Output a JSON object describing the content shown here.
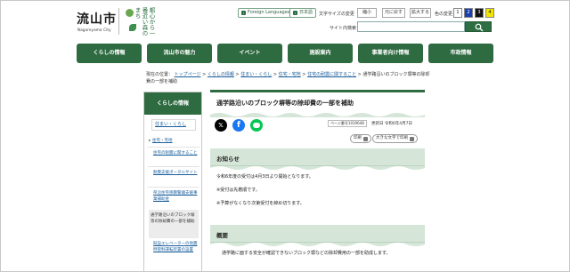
{
  "header": {
    "logo_kanji": "流山市",
    "logo_roman": "Nagareyama City",
    "slogan": "都心から一番近い森のまち",
    "lang_button": "Foreign Languages",
    "japanese_button": "日本語",
    "text_size_label": "文字サイズの変更",
    "text_size_shrink": "縮小",
    "text_size_reset": "元に戻す",
    "text_size_enlarge": "拡大する",
    "color_label": "色の変更",
    "color_options": [
      "1",
      "2",
      "3",
      "4"
    ],
    "search_label": "サイト内検索",
    "search_placeholder": ""
  },
  "gnav": [
    "くらしの情報",
    "流山市の魅力",
    "イベント",
    "施設案内",
    "事業者向け情報",
    "市政情報"
  ],
  "breadcrumb": {
    "prefix": "現在の位置：",
    "links": [
      "トップページ",
      "くらしの情報",
      "住まい・くらし",
      "住宅・宅地",
      "住宅の耐震に関すること"
    ],
    "current": "通学路沿いのブロック塀等の除却費の一部を補助",
    "separator": " > "
  },
  "sidebar": {
    "heading": "くらしの情報",
    "sub_heading": "住まい・くらし",
    "items": [
      "住宅・宅地",
      "住宅の耐震に関すること",
      "耐震支援ポータルサイト",
      "県沿住宅感震警鐘支援事業補助金"
    ],
    "current": "通学路沿いのブロック塀等の除却費の一部を補助",
    "after_items": [
      "既設エレベーターの地震時管制運転装置の設置"
    ]
  },
  "page": {
    "title": "通学路沿いのブロック塀等の除却費の一部を補助",
    "page_id": "ページ番号1019648",
    "updated": "更新日 令和6年4月7日",
    "print_button": "印刷",
    "print_large_button": "大きな文字で印刷",
    "sections": [
      {
        "heading": "お知らせ",
        "lines": [
          "令和6年度の受付は4月3日より開始となります。",
          "※受付は先着順です。",
          "※予算がなくなり次第受付を締め切ります。"
        ]
      },
      {
        "heading": "概要",
        "lines": [
          "通学路に面する安全が確認できないブロック塀などの除却費用の一部を助成します。"
        ]
      }
    ]
  },
  "colors": {
    "brand_green": "#2e6b41",
    "section_bg": "#d5e6d8",
    "link_blue": "#1a5e9a"
  },
  "icons": {
    "sns": [
      "x-icon",
      "facebook-icon",
      "line-icon"
    ],
    "search": "search-icon",
    "print": "printer-icon"
  }
}
